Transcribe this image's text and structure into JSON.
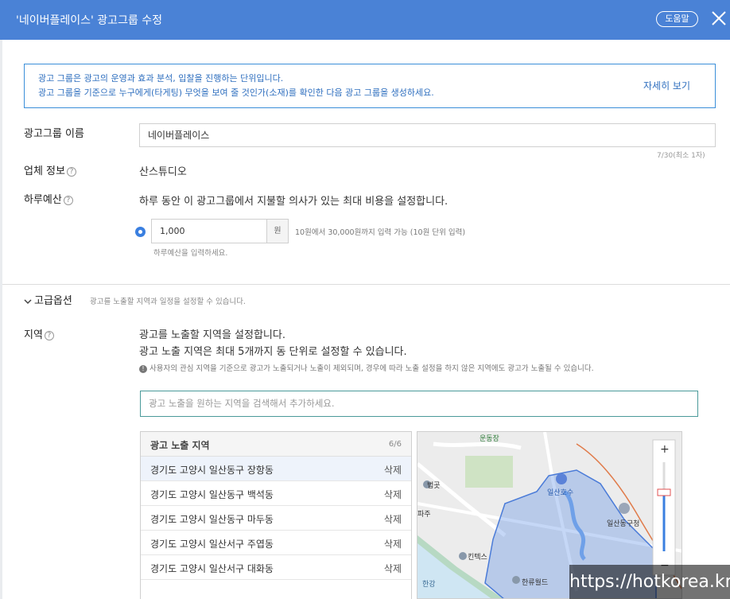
{
  "header": {
    "title": "'네이버플레이스' 광고그룹 수정",
    "help_label": "도움말"
  },
  "info": {
    "line1": "광고 그룹은 광고의 운영과 효과 분석, 입찰을 진행하는 단위입니다.",
    "line2": "광고 그룹을 기준으로 누구에게(타게팅) 무엇을 보여 줄 것인가(소재)를 확인한 다음 광고 그룹을 생성하세요.",
    "more_label": "자세히 보기"
  },
  "group_name": {
    "label": "광고그룹 이름",
    "value": "네이버플레이스",
    "counter": "7/30(최소 1자)"
  },
  "business": {
    "label": "업체 정보",
    "value": "산스튜디오"
  },
  "daily_budget": {
    "label": "하루예산",
    "description": "하루 동안 이 광고그룹에서 지불할 의사가 있는 최대 비용을 설정합니다.",
    "value": "1,000",
    "unit": "원",
    "hint": "10원에서 30,000원까지 입력 가능 (10원 단위 입력)",
    "sub_hint": "하루예산을 입력하세요."
  },
  "advanced": {
    "label": "고급옵션",
    "description": "광고를 노출할 지역과 일정을 설정할 수 있습니다."
  },
  "region": {
    "label": "지역",
    "desc1": "광고를 노출할 지역을 설정합니다.",
    "desc2": "광고 노출 지역은 최대 5개까지 동 단위로 설정할 수 있습니다.",
    "note": "사용자의 관심 지역을 기준으로 광고가 노출되거나 노출이 제외되며, 경우에 따라 노출 설정을 하지 않은 지역에도 광고가 노출될 수 있습니다.",
    "search_placeholder": "광고 노출을 원하는 지역을 검색해서 추가하세요.",
    "list_title": "광고 노출 지역",
    "list_count": "6/6",
    "delete_label": "삭제",
    "items": [
      "경기도 고양시 일산동구 장항동",
      "경기도 고양시 일산동구 백석동",
      "경기도 고양시 일산동구 마두동",
      "경기도 고양시 일산서구 주엽동",
      "경기도 고양시 일산서구 대화동"
    ]
  },
  "map": {
    "labels": [
      "운동장",
      "법곳",
      "일산호수",
      "일산동구청",
      "킨텍스",
      "한류월드",
      "한강",
      "파주"
    ]
  },
  "watermark": "https://hotkorea.kr"
}
